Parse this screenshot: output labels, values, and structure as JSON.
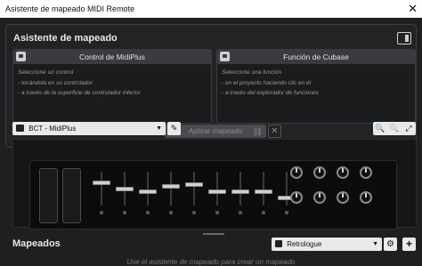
{
  "window": {
    "title": "Asistente de mapeado MIDI Remote",
    "close_glyph": "✕"
  },
  "assistant": {
    "title": "Asistente de mapeado",
    "left": {
      "header": "Control de MidiPlus",
      "lines": [
        "Seleccione un control",
        "- tocándola en su controlador",
        "- a través de la superficie de controlador inferior"
      ]
    },
    "right": {
      "header": "Función de Cubase",
      "lines": [
        "Seleccione una función",
        "- en el proyecto haciendo clic en él",
        "- a través del explorador de funciones"
      ]
    },
    "apply_label": "Aplicar mapeado",
    "cancel_glyph": "✕"
  },
  "surface": {
    "device_name": "BCT - MidiPlus",
    "edit_glyph": "✎",
    "zoom_glyphs": [
      "🔍",
      "🔍",
      "⤢"
    ],
    "faders": [
      0.7,
      0.5,
      0.4,
      0.6,
      0.65,
      0.4,
      0.4,
      0.4,
      0.2
    ],
    "knob_rows": 2,
    "knobs_per_row": 4
  },
  "mappings": {
    "title": "Mapeados",
    "preset": "Retrologue",
    "gear_glyph": "⚙",
    "add_glyph": "+",
    "hint": "Use el asistente de mapeado para crear un mapeado"
  },
  "colors": {
    "panel_bg": "#222325",
    "button_light": "#e9e9e9",
    "text_primary": "#e8e8e8"
  },
  "icons": [
    "unlink-icon",
    "device-icon",
    "pencil-icon",
    "zoom-in-icon",
    "zoom-out-icon",
    "expand-icon",
    "gear-icon",
    "plus-icon"
  ]
}
